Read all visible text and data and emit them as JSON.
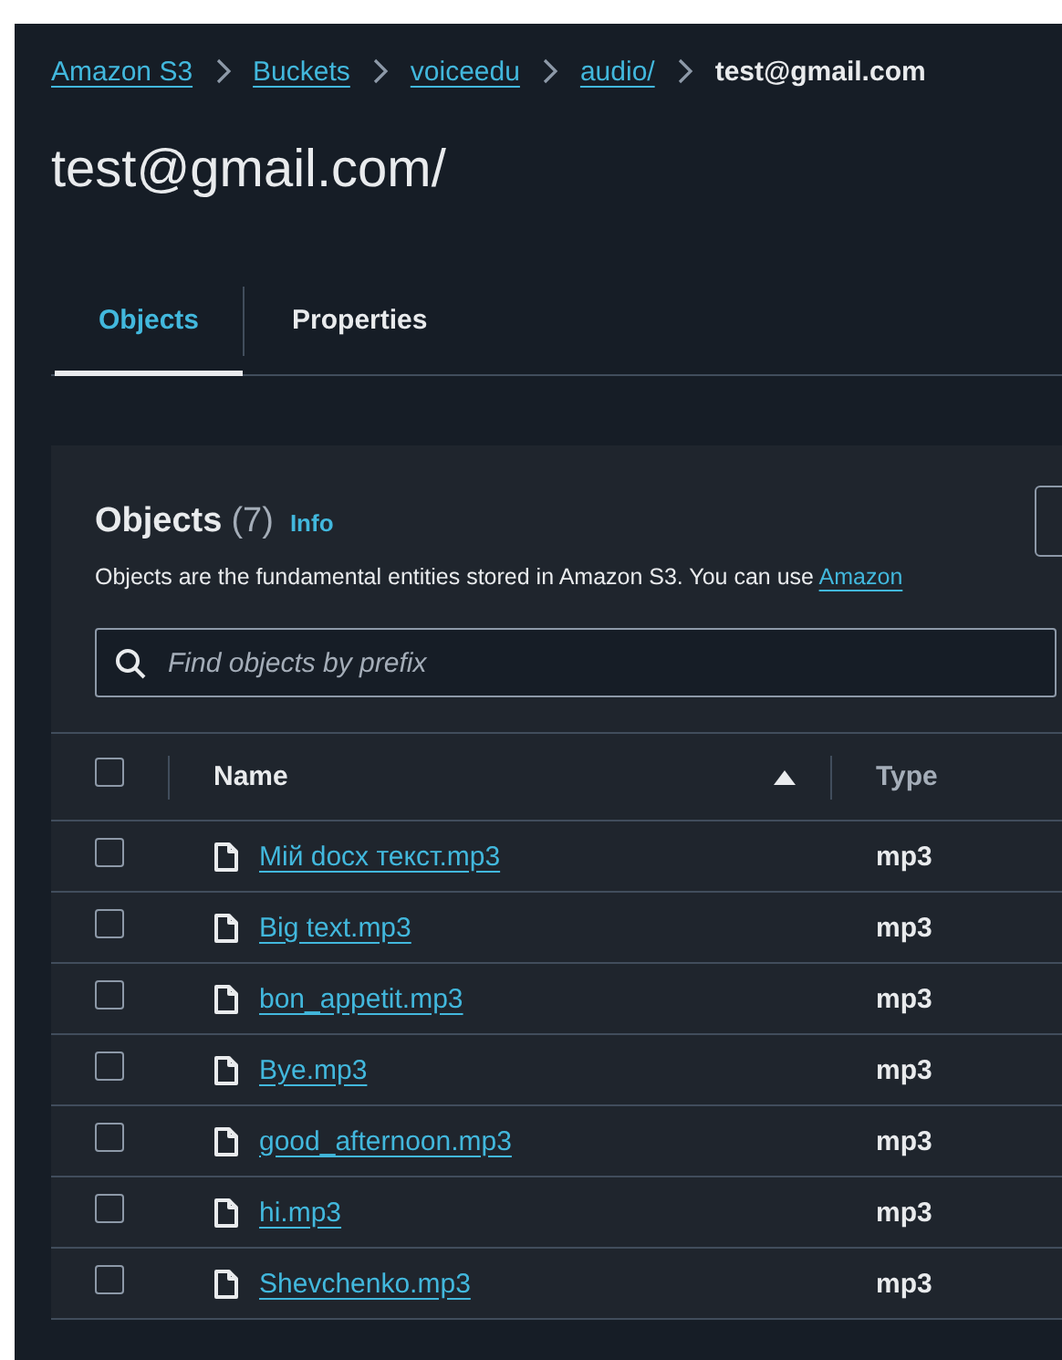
{
  "breadcrumbs": [
    {
      "label": "Amazon S3",
      "link": true
    },
    {
      "label": "Buckets",
      "link": true
    },
    {
      "label": "voiceedu",
      "link": true
    },
    {
      "label": "audio/",
      "link": true
    },
    {
      "label": "test@gmail.com",
      "link": false
    }
  ],
  "title": "test@gmail.com/",
  "tabs": [
    {
      "label": "Objects",
      "selected": true
    },
    {
      "label": "Properties",
      "selected": false
    }
  ],
  "objects_panel": {
    "heading": "Objects",
    "count": "(7)",
    "info": "Info",
    "description": "Objects are the fundamental entities stored in Amazon S3. You can use ",
    "description_link": "Amazon",
    "search": {
      "placeholder": "Find objects by prefix"
    },
    "columns": [
      {
        "label": "Name",
        "sorted": true
      },
      {
        "label": "Type",
        "sorted": false
      }
    ],
    "select_all": {
      "checked": false
    },
    "rows": [
      {
        "name": "Мій docx текст.mp3",
        "type": "mp3",
        "checked": false
      },
      {
        "name": "Big text.mp3",
        "type": "mp3",
        "checked": false
      },
      {
        "name": "bon_appetit.mp3",
        "type": "mp3",
        "checked": false
      },
      {
        "name": "Bye.mp3",
        "type": "mp3",
        "checked": false
      },
      {
        "name": "good_afternoon.mp3",
        "type": "mp3",
        "checked": false
      },
      {
        "name": "hi.mp3",
        "type": "mp3",
        "checked": false
      },
      {
        "name": "Shevchenko.mp3",
        "type": "mp3",
        "checked": false
      }
    ]
  }
}
